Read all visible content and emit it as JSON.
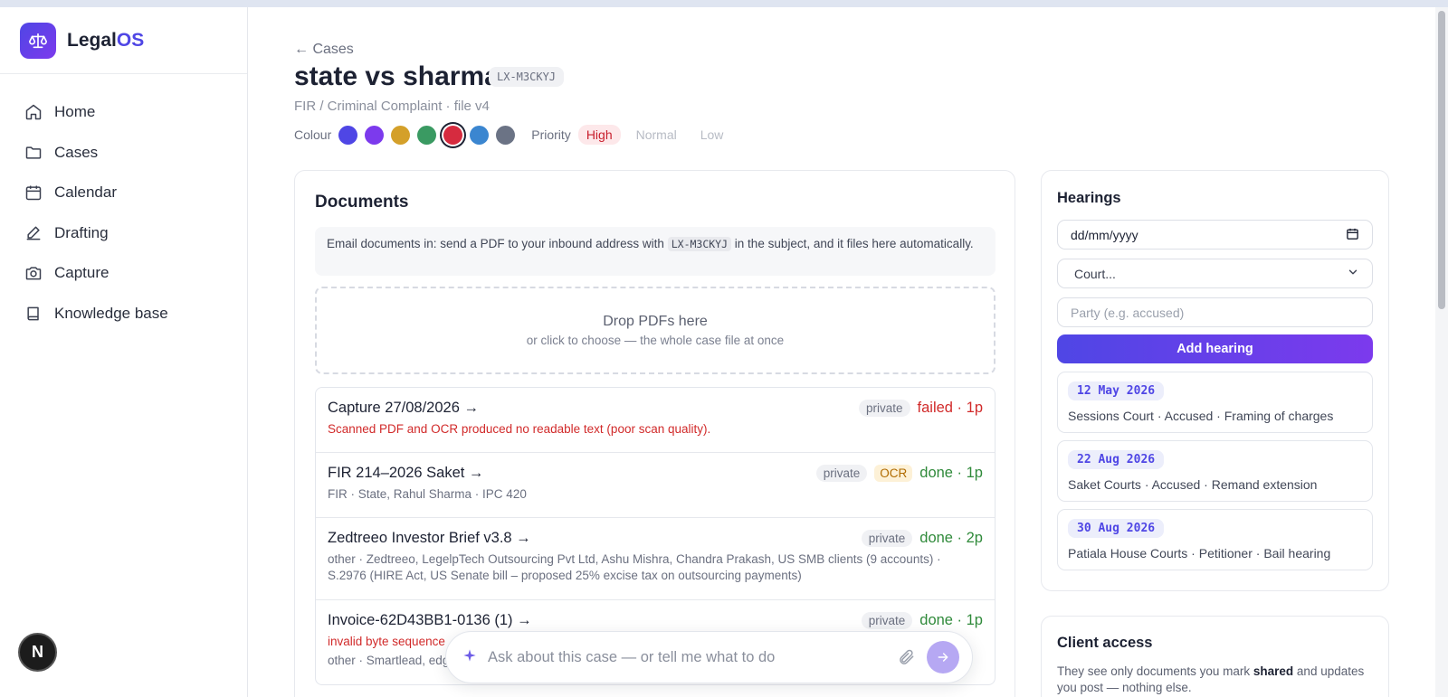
{
  "brand": {
    "name_a": "Legal",
    "name_b": "OS"
  },
  "nav": [
    {
      "label": "Home",
      "icon": "home-icon"
    },
    {
      "label": "Cases",
      "icon": "folder-icon"
    },
    {
      "label": "Calendar",
      "icon": "calendar-icon"
    },
    {
      "label": "Drafting",
      "icon": "pen-icon"
    },
    {
      "label": "Capture",
      "icon": "camera-icon"
    },
    {
      "label": "Knowledge base",
      "icon": "book-icon"
    }
  ],
  "user_avatar": "N",
  "case": {
    "back_label": "← Cases",
    "title": "state vs sharma",
    "code": "LX-M3CKYJ",
    "subtitle": "FIR / Criminal Complaint · file v4",
    "colour_label": "Colour",
    "colours": [
      "#4f46e5",
      "#7c3aed",
      "#d4a02a",
      "#3a9a62",
      "#d62b3f",
      "#3b86d0",
      "#6b7385"
    ],
    "selected_colour": "#d62b3f",
    "priority_label": "Priority",
    "priorities": [
      "High",
      "Normal",
      "Low"
    ],
    "selected_priority": "High"
  },
  "documents": {
    "title": "Documents",
    "email_note_a": "Email documents in: send a PDF to your inbound address with",
    "email_note_code": "LX-M3CKYJ",
    "email_note_b": "in the subject, and it files here automatically.",
    "drop_main": "Drop PDFs here",
    "drop_sub": "or click to choose — the whole case file at once",
    "items": [
      {
        "name": "Capture 27/08/2026 →",
        "visibility": "private",
        "ocr": "",
        "status": "failed · 1p",
        "status_kind": "failed",
        "detail": "Scanned PDF and OCR produced no readable text (poor scan quality).",
        "detail_kind": "err"
      },
      {
        "name": "FIR 214–2026 Saket →",
        "visibility": "private",
        "ocr": "OCR",
        "status": "done · 1p",
        "status_kind": "done",
        "detail": "FIR · State, Rahul Sharma · IPC 420",
        "detail_kind": "normal"
      },
      {
        "name": "Zedtreeo Investor Brief v3.8 →",
        "visibility": "private",
        "ocr": "",
        "status": "done · 2p",
        "status_kind": "done",
        "detail": "other · Zedtreeo, LegelpTech Outsourcing Pvt Ltd, Ashu Mishra, Chandra Prakash, US SMB clients (9 accounts) · S.2976 (HIRE Act, US Senate bill – proposed 25% excise tax on outsourcing payments)",
        "detail_kind": "normal"
      },
      {
        "name": "Invoice-62D43BB1-0136 (1) →",
        "visibility": "private",
        "ocr": "",
        "status": "done · 1p",
        "status_kind": "done",
        "detail": "invalid byte sequence",
        "detail_kind": "err",
        "detail2": "other · Smartlead, edg"
      }
    ]
  },
  "ask": {
    "placeholder": "Ask about this case — or tell me what to do"
  },
  "hearings": {
    "title": "Hearings",
    "date_placeholder": "dd/mm/yyyy",
    "court_placeholder": "Court...",
    "party_placeholder": "Party (e.g. accused)",
    "add_label": "Add hearing",
    "items": [
      {
        "date": "12 May 2026",
        "detail": "Sessions Court · Accused · Framing of charges"
      },
      {
        "date": "22 Aug 2026",
        "detail": "Saket Courts · Accused · Remand extension"
      },
      {
        "date": "30 Aug 2026",
        "detail": "Patiala House Courts · Petitioner · Bail hearing"
      }
    ]
  },
  "client_access": {
    "title": "Client access",
    "text_a": "They see only documents you mark",
    "text_bold": "shared",
    "text_b": "and updates you post — nothing else."
  }
}
